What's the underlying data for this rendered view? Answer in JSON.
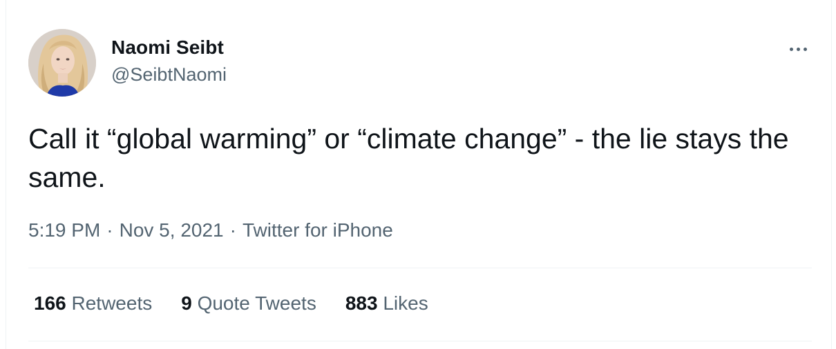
{
  "tweet": {
    "author_name": "Naomi Seibt",
    "author_handle": "@SeibtNaomi",
    "more_icon": "more-horizontal-icon",
    "text": "Call it “global warming” or “climate change” - the lie stays the same.",
    "time": "5:19 PM",
    "date": "Nov 5, 2021",
    "source": "Twitter for iPhone",
    "separator": "·"
  },
  "stats": [
    {
      "count": "166",
      "label": "Retweets"
    },
    {
      "count": "9",
      "label": "Quote Tweets"
    },
    {
      "count": "883",
      "label": "Likes"
    }
  ],
  "colors": {
    "text_primary": "#0f1419",
    "text_secondary": "#536471",
    "divider": "#eff3f4",
    "background": "#ffffff"
  }
}
